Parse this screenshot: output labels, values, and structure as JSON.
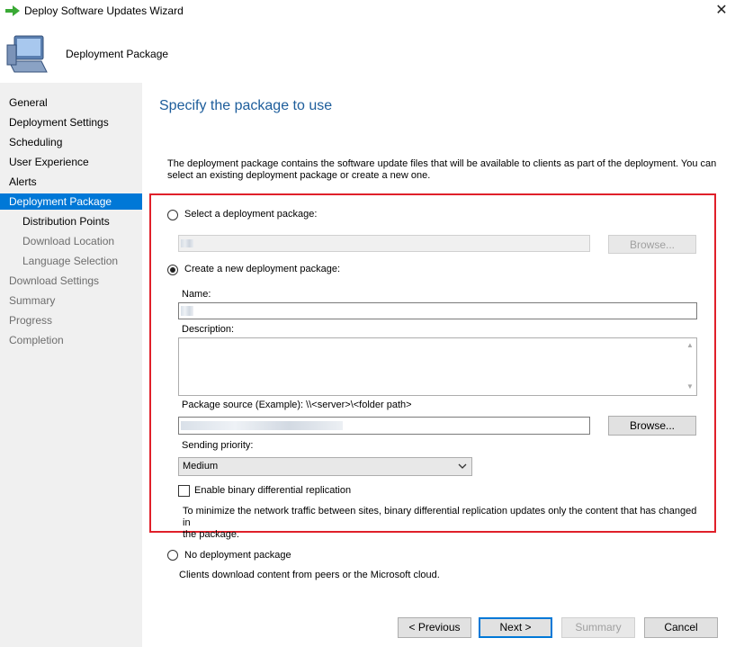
{
  "window": {
    "title": "Deploy Software Updates Wizard",
    "close_glyph": "✕"
  },
  "header": {
    "title": "Deployment Package"
  },
  "sidebar": {
    "items": [
      {
        "label": "General"
      },
      {
        "label": "Deployment Settings"
      },
      {
        "label": "Scheduling"
      },
      {
        "label": "User Experience"
      },
      {
        "label": "Alerts"
      },
      {
        "label": "Deployment Package"
      },
      {
        "label": "Distribution Points"
      },
      {
        "label": "Download Location"
      },
      {
        "label": "Language Selection"
      },
      {
        "label": "Download Settings"
      },
      {
        "label": "Summary"
      },
      {
        "label": "Progress"
      },
      {
        "label": "Completion"
      }
    ]
  },
  "main": {
    "title": "Specify the package to use",
    "intro_line1": "The deployment package contains the software update files that will be available to clients as part of the deployment. You can",
    "intro_line2": "select an existing deployment package or create a new one.",
    "select_existing": {
      "label": "Select a deployment package:",
      "browse_label": "Browse..."
    },
    "create_new": {
      "label": "Create a new deployment package:",
      "name_label": "Name:",
      "description_label": "Description:",
      "source_label": "Package source (Example): \\\\<server>\\<folder path>",
      "browse_label": "Browse...",
      "priority_label": "Sending priority:",
      "priority_value": "Medium",
      "binary_label": "Enable binary differential replication",
      "binary_help_line1": "To minimize the network traffic between sites, binary differential replication updates only the content that has changed in",
      "binary_help_line2": "the package."
    },
    "no_package": {
      "label": "No deployment package",
      "help": "Clients download content from peers or the Microsoft cloud."
    }
  },
  "footer": {
    "previous": "< Previous",
    "next": "Next >",
    "summary": "Summary",
    "cancel": "Cancel"
  },
  "colors": {
    "accent": "#0078d7",
    "title_blue": "#1d5d9b",
    "highlight_border": "#e0202a"
  }
}
